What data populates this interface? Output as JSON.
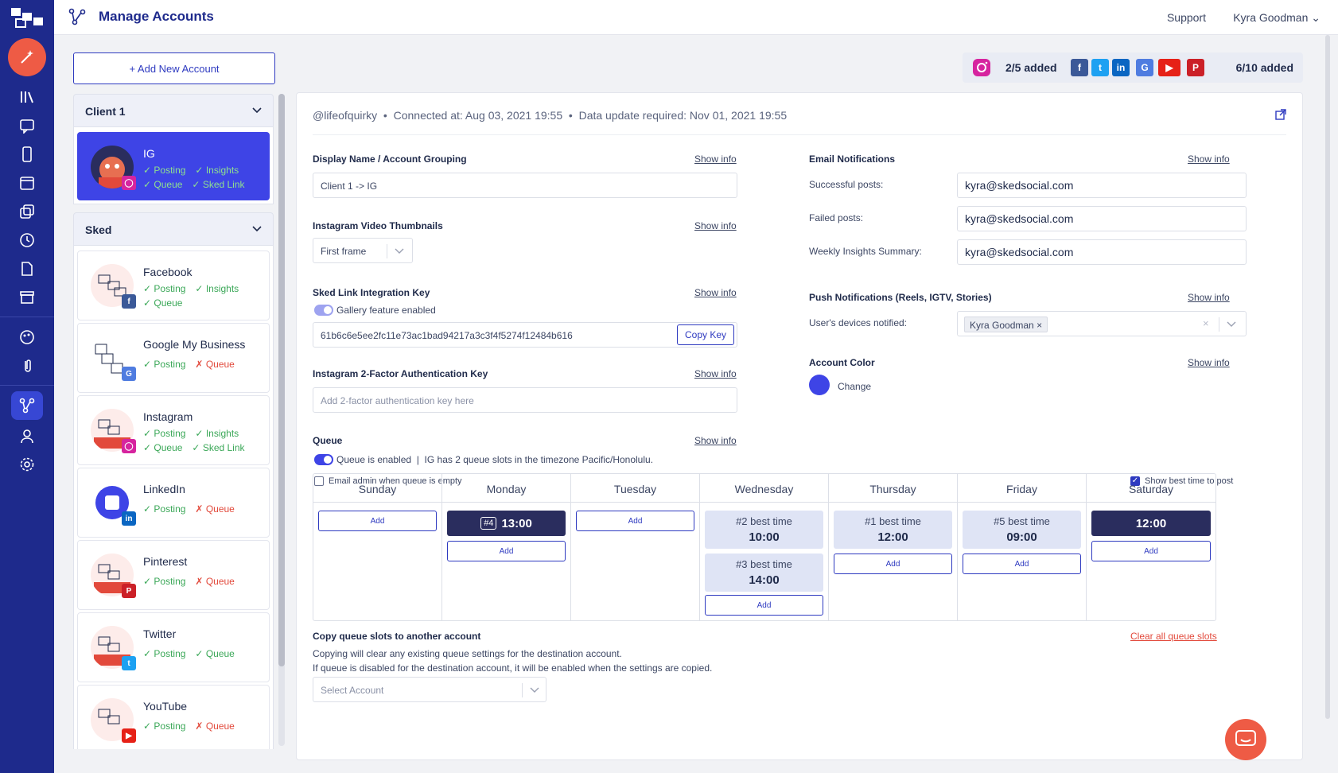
{
  "app": {
    "title": "Manage Accounts"
  },
  "topbar": {
    "support": "Support",
    "user": "Kyra Goodman"
  },
  "sidebar_icons": [
    "logo-icon",
    "magic-wand-icon",
    "library-icon",
    "chat-icon",
    "mobile-icon",
    "calendar-icon",
    "copy-icon",
    "history-icon",
    "document-icon",
    "archive-icon",
    "palette-icon",
    "clip-icon",
    "accounts-icon",
    "user-icon",
    "settings-icon"
  ],
  "add_account": "+ Add New Account",
  "quota": {
    "ig": "2/5 added",
    "others": "6/10 added"
  },
  "groups": [
    {
      "name": "Client 1",
      "accounts": [
        {
          "name": "IG",
          "network": "instagram",
          "features": [
            [
              "Posting",
              "ok"
            ],
            [
              "Insights",
              "ok"
            ],
            [
              "Queue",
              "ok"
            ],
            [
              "Sked Link",
              "ok"
            ]
          ]
        }
      ]
    },
    {
      "name": "Sked",
      "accounts": [
        {
          "name": "Facebook",
          "network": "facebook",
          "features": [
            [
              "Posting",
              "ok"
            ],
            [
              "Insights",
              "ok"
            ],
            [
              "Queue",
              "ok"
            ]
          ]
        },
        {
          "name": "Google My Business",
          "network": "gmb",
          "features": [
            [
              "Posting",
              "ok"
            ],
            [
              "Queue",
              "no"
            ]
          ]
        },
        {
          "name": "Instagram",
          "network": "instagram",
          "features": [
            [
              "Posting",
              "ok"
            ],
            [
              "Insights",
              "ok"
            ],
            [
              "Queue",
              "ok"
            ],
            [
              "Sked Link",
              "ok"
            ]
          ]
        },
        {
          "name": "LinkedIn",
          "network": "linkedin",
          "features": [
            [
              "Posting",
              "ok"
            ],
            [
              "Queue",
              "no"
            ]
          ]
        },
        {
          "name": "Pinterest",
          "network": "pinterest",
          "features": [
            [
              "Posting",
              "ok"
            ],
            [
              "Queue",
              "no"
            ]
          ]
        },
        {
          "name": "Twitter",
          "network": "twitter",
          "features": [
            [
              "Posting",
              "ok"
            ],
            [
              "Queue",
              "ok"
            ]
          ]
        },
        {
          "name": "YouTube",
          "network": "youtube",
          "features": [
            [
              "Posting",
              "ok"
            ],
            [
              "Queue",
              "no"
            ]
          ]
        }
      ]
    }
  ],
  "panel": {
    "handle": "@lifeofquirky",
    "connected": "Connected at: Aug 03, 2021 19:55",
    "update": "Data update required: Nov 01, 2021 19:55",
    "show_info": "Show info",
    "display_name_label": "Display Name / Account Grouping",
    "display_name_value": "Client 1 -> IG",
    "thumb_label": "Instagram Video Thumbnails",
    "thumb_value": "First frame",
    "skedlink_label": "Sked Link Integration Key",
    "gallery_label": "Gallery feature enabled",
    "key_value": "61b6c6e5ee2fc11e73ac1bad94217a3c3f4f5274f12484b616",
    "copy_key": "Copy Key",
    "twofa_label": "Instagram 2-Factor Authentication Key",
    "twofa_placeholder": "Add 2-factor authentication key here",
    "email_notif_label": "Email Notifications",
    "successful_label": "Successful posts:",
    "failed_label": "Failed posts:",
    "weekly_label": "Weekly Insights Summary:",
    "email_value": "kyra@skedsocial.com",
    "push_label": "Push Notifications (Reels, IGTV, Stories)",
    "devices_label": "User's devices notified:",
    "device_chip": "Kyra Goodman",
    "color_label": "Account Color",
    "change": "Change",
    "queue_label": "Queue",
    "queue_enabled": "Queue is enabled",
    "queue_info": "IG has 2 queue slots in the timezone Pacific/Honolulu.",
    "email_admin": "Email admin when queue is empty",
    "best_time_toggle": "Show best time to post",
    "copy_title": "Copy queue slots to another account",
    "copy_line1": "Copying will clear any existing queue settings for the destination account.",
    "copy_line2": "If queue is disabled for the destination account, it will be enabled when the settings are copied.",
    "select_account": "Select Account",
    "clear_all": "Clear all queue slots"
  },
  "schedule": {
    "days": [
      "Sunday",
      "Monday",
      "Tuesday",
      "Wednesday",
      "Thursday",
      "Friday",
      "Saturday"
    ],
    "add": "Add",
    "monday_slot": {
      "num": "#4",
      "time": "13:00"
    },
    "wed": [
      {
        "label": "#2 best time",
        "time": "10:00"
      },
      {
        "label": "#3 best time",
        "time": "14:00"
      }
    ],
    "thu": {
      "label": "#1 best time",
      "time": "12:00"
    },
    "fri": {
      "label": "#5 best time",
      "time": "09:00"
    },
    "sat_slot": "12:00"
  },
  "colors": {
    "nav": "#1e2a8c",
    "accent": "#3e44e6",
    "brand_red": "#ee5b45"
  }
}
